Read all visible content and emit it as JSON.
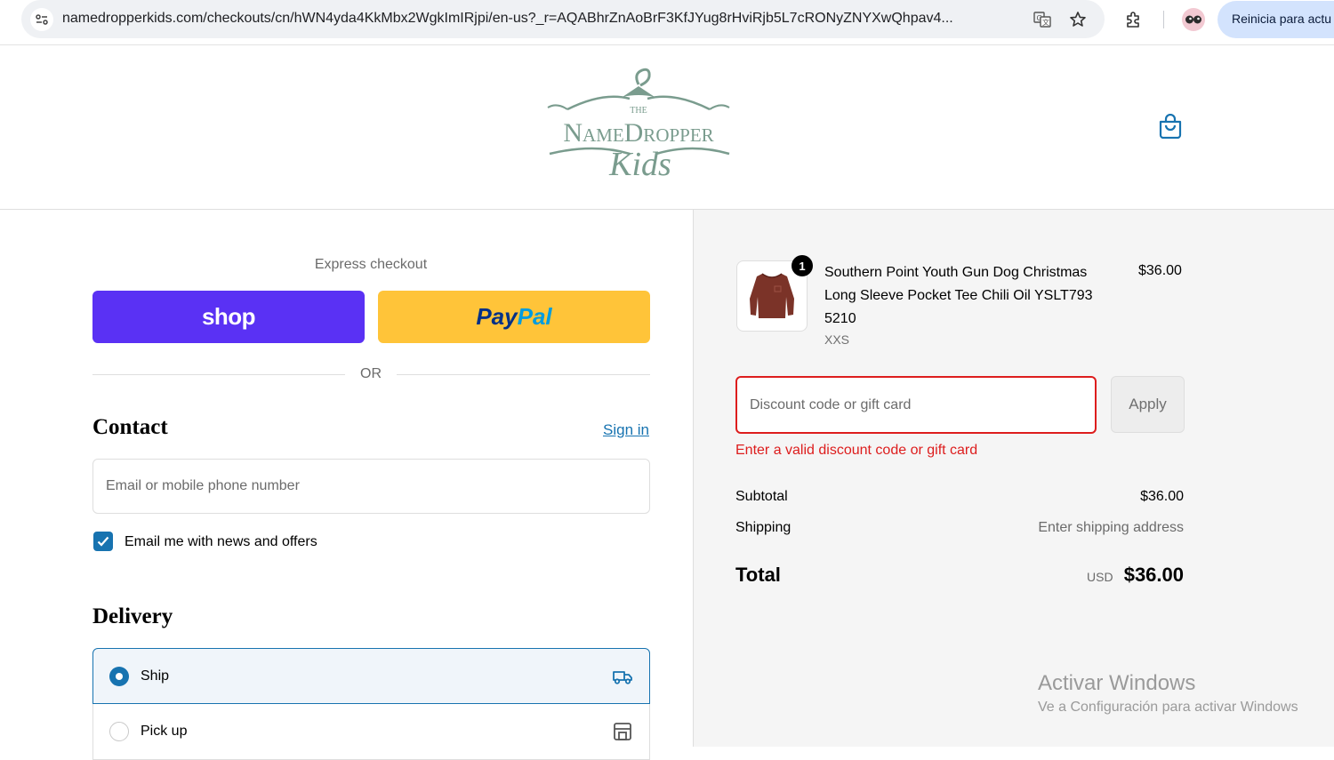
{
  "browser": {
    "url": "namedropperkids.com/checkouts/cn/hWN4yda4KkMbx2WgkImIRjpi/en-us?_r=AQABhrZnAoBrF3KfJYug8rHviRjb5L7cRONyZNYXwQhpav4...",
    "relaunch_label": "Reinicia para actu"
  },
  "header": {
    "logo_the": "THE",
    "logo_name": "NameDropper",
    "logo_kids": "Kids"
  },
  "express": {
    "label": "Express checkout",
    "shop_label": "shop",
    "paypal_part1": "Pay",
    "paypal_part2": "Pal",
    "or_label": "OR"
  },
  "contact": {
    "title": "Contact",
    "signin_label": "Sign in",
    "email_placeholder": "Email or mobile phone number",
    "newsletter_label": "Email me with news and offers",
    "newsletter_checked": true
  },
  "delivery": {
    "title": "Delivery",
    "options": [
      {
        "label": "Ship",
        "selected": true
      },
      {
        "label": "Pick up",
        "selected": false
      }
    ]
  },
  "summary": {
    "product": {
      "quantity": "1",
      "name": "Southern Point Youth Gun Dog Christmas Long Sleeve Pocket Tee Chili Oil YSLT793 5210",
      "variant": "XXS",
      "price": "$36.00"
    },
    "discount_placeholder": "Discount code or gift card",
    "apply_label": "Apply",
    "discount_error": "Enter a valid discount code or gift card",
    "subtotal_label": "Subtotal",
    "subtotal_value": "$36.00",
    "shipping_label": "Shipping",
    "shipping_value": "Enter shipping address",
    "total_label": "Total",
    "total_currency": "USD",
    "total_value": "$36.00"
  },
  "watermark": {
    "title": "Activar Windows",
    "subtitle": "Ve a Configuración para activar Windows"
  },
  "colors": {
    "accent": "#1773b0",
    "error": "#dd1d1d",
    "shop_purple": "#5a31f4",
    "paypal_yellow": "#ffc439",
    "logo_green": "#7a9c8e"
  }
}
